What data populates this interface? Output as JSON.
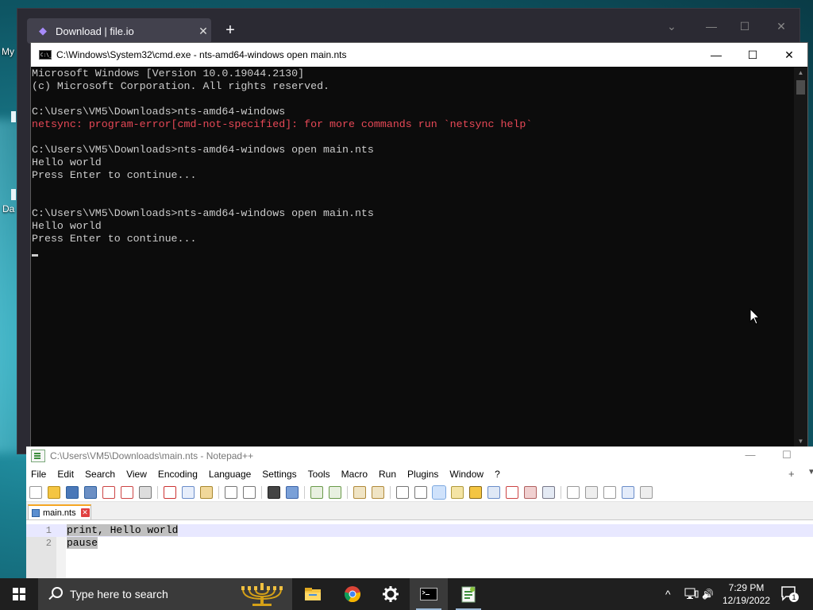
{
  "desktop": {
    "labels": [
      "My",
      "Da"
    ]
  },
  "browser": {
    "tab_title": "Download | file.io",
    "tab_close": "✕",
    "new_tab": "+",
    "controls": [
      "⌄",
      "—",
      "☐",
      "✕"
    ]
  },
  "cmd": {
    "title": "C:\\Windows\\System32\\cmd.exe - nts-amd64-windows  open main.nts",
    "icon_text": "C:\\_",
    "controls": {
      "minimize": "—",
      "maximize": "☐",
      "close": "✕"
    },
    "lines": [
      {
        "text": "Microsoft Windows [Version 10.0.19044.2130]",
        "type": "normal"
      },
      {
        "text": "(c) Microsoft Corporation. All rights reserved.",
        "type": "normal"
      },
      {
        "text": "",
        "type": "normal"
      },
      {
        "text": "C:\\Users\\VM5\\Downloads>nts-amd64-windows",
        "type": "normal"
      },
      {
        "text": "netsync: program-error[cmd-not-specified]: for more commands run `netsync help`",
        "type": "err"
      },
      {
        "text": "",
        "type": "normal"
      },
      {
        "text": "C:\\Users\\VM5\\Downloads>nts-amd64-windows open main.nts",
        "type": "normal"
      },
      {
        "text": "Hello world",
        "type": "normal"
      },
      {
        "text": "Press Enter to continue...",
        "type": "normal"
      },
      {
        "text": "",
        "type": "normal"
      },
      {
        "text": "",
        "type": "normal"
      },
      {
        "text": "C:\\Users\\VM5\\Downloads>nts-amd64-windows open main.nts",
        "type": "normal"
      },
      {
        "text": "Hello world",
        "type": "normal"
      },
      {
        "text": "Press Enter to continue...",
        "type": "normal"
      }
    ]
  },
  "notepad": {
    "title": "C:\\Users\\VM5\\Downloads\\main.nts - Notepad++",
    "controls": {
      "minimize": "—",
      "maximize": "☐"
    },
    "menu": [
      "File",
      "Edit",
      "Search",
      "View",
      "Encoding",
      "Language",
      "Settings",
      "Tools",
      "Macro",
      "Run",
      "Plugins",
      "Window",
      "?"
    ],
    "menu_plus": "+",
    "menu_dropdown": "▼",
    "tab": {
      "label": "main.nts",
      "close": "✕"
    },
    "code_lines": [
      {
        "number": "1",
        "text": "print, Hello world"
      },
      {
        "number": "2",
        "text": "pause"
      }
    ]
  },
  "taskbar": {
    "search_placeholder": "Type here to search",
    "apps": [
      "file-explorer",
      "chrome",
      "settings",
      "command-prompt",
      "notepad-plus-plus"
    ],
    "time": "7:29 PM",
    "date": "12/19/2022",
    "notification_count": "1",
    "tray_chevron": "^",
    "volume": "🔊"
  },
  "colors": {
    "cmd_bg": "#0c0c0c",
    "cmd_text": "#cccccc",
    "cmd_error": "#e74856",
    "taskbar_bg": "#1f1f1f",
    "browser_bg": "#2b2a33"
  }
}
